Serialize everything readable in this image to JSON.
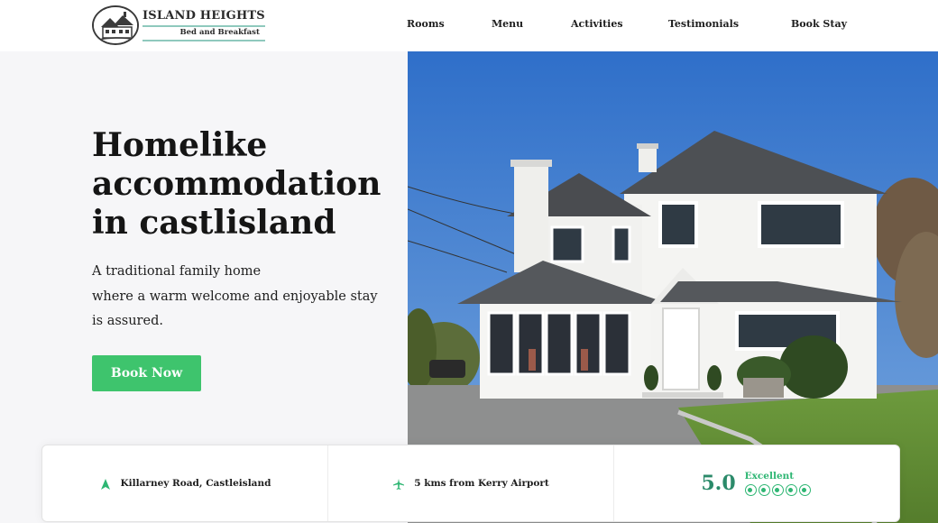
{
  "header": {
    "logo": {
      "title": "ISLAND HEIGHTS",
      "subtitle": "Bed and Breakfast"
    },
    "nav": [
      {
        "label": "Rooms"
      },
      {
        "label": "Menu"
      },
      {
        "label": "Activities"
      },
      {
        "label": "Testimonials"
      },
      {
        "label": "Book Stay"
      }
    ]
  },
  "hero": {
    "title": "Homelike\naccommodation\nin castlisland",
    "description": "A traditional family home\nwhere a warm welcome and enjoyable stay\nis assured.",
    "cta_label": "Book Now",
    "photo_icon": "house-photo"
  },
  "info_bar": {
    "location": {
      "icon": "location-arrow-icon",
      "text": "Killarney Road, Castleisland"
    },
    "airport": {
      "icon": "airplane-icon",
      "text": "5 kms from Kerry Airport"
    },
    "rating": {
      "score": "5.0",
      "label": "Excellent",
      "circles": 5
    }
  },
  "colors": {
    "accent_green": "#3ec46d",
    "rating_green": "#2eb673",
    "score_teal": "#2b8a6a",
    "logo_rule": "#8fc9bd",
    "hero_bg": "#f6f6f8"
  }
}
